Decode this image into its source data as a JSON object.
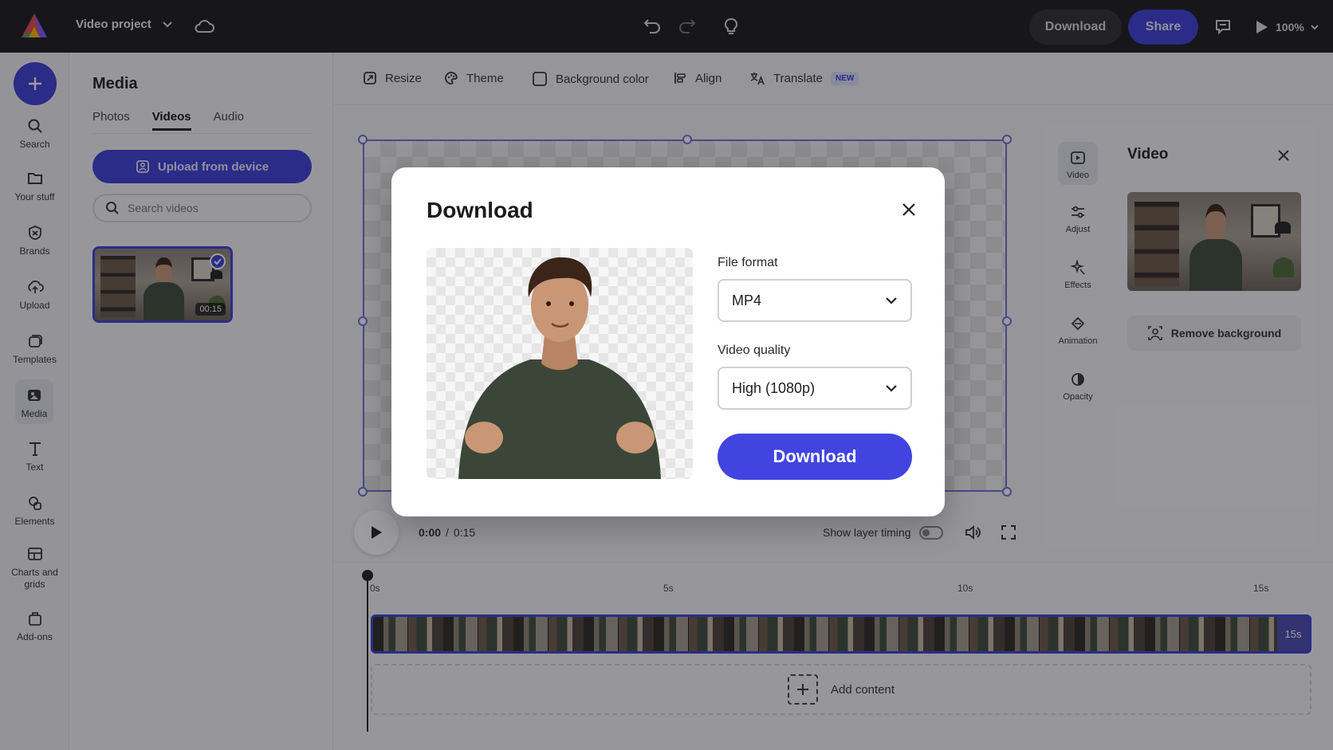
{
  "topbar": {
    "project_title": "Video project",
    "download_label": "Download",
    "share_label": "Share",
    "zoom": "100%",
    "icons": [
      "adobe-express-logo",
      "chevron-down-icon",
      "cloud-icon",
      "undo-icon",
      "redo-icon",
      "lightbulb-icon",
      "comment-icon",
      "play-icon"
    ]
  },
  "rail": {
    "items": [
      {
        "label": "Search",
        "icon": "search-icon"
      },
      {
        "label": "Your stuff",
        "icon": "folder-icon"
      },
      {
        "label": "Brands",
        "icon": "brand-icon"
      },
      {
        "label": "Upload",
        "icon": "upload-icon"
      },
      {
        "label": "Templates",
        "icon": "templates-icon"
      },
      {
        "label": "Media",
        "icon": "media-icon"
      },
      {
        "label": "Text",
        "icon": "text-icon"
      },
      {
        "label": "Elements",
        "icon": "elements-icon"
      },
      {
        "label": "Charts and grids",
        "icon": "charts-icon"
      },
      {
        "label": "Add-ons",
        "icon": "addons-icon"
      }
    ],
    "active": "Media"
  },
  "media": {
    "title": "Media",
    "tabs": [
      "Photos",
      "Videos",
      "Audio"
    ],
    "active_tab": "Videos",
    "upload_label": "Upload from device",
    "search_placeholder": "Search videos",
    "thumb_duration": "00:15"
  },
  "toolbar": {
    "resize": "Resize",
    "theme": "Theme",
    "background_color": "Background color",
    "align": "Align",
    "translate": "Translate",
    "new_badge": "NEW"
  },
  "playback": {
    "current": "0:00",
    "separator": "/",
    "total": "0:15",
    "show_layer_timing": "Show layer timing"
  },
  "timeline": {
    "ticks": [
      "0s",
      "5s",
      "10s",
      "15s"
    ],
    "clip_duration": "15s",
    "add_content": "Add content"
  },
  "properties": {
    "items": [
      {
        "label": "Video",
        "icon": "video-icon"
      },
      {
        "label": "Adjust",
        "icon": "sliders-icon"
      },
      {
        "label": "Effects",
        "icon": "effects-icon"
      },
      {
        "label": "Animation",
        "icon": "animation-icon"
      },
      {
        "label": "Opacity",
        "icon": "opacity-icon"
      }
    ],
    "active": "Video",
    "panel_title": "Video",
    "remove_background": "Remove background"
  },
  "modal": {
    "title": "Download",
    "file_format_label": "File format",
    "file_format_value": "MP4",
    "video_quality_label": "Video quality",
    "video_quality_value": "High (1080p)",
    "download_button": "Download"
  },
  "colors": {
    "accent": "#3b3fd6",
    "topbar": "#1b1b1d",
    "modal_button": "#4244e0"
  }
}
